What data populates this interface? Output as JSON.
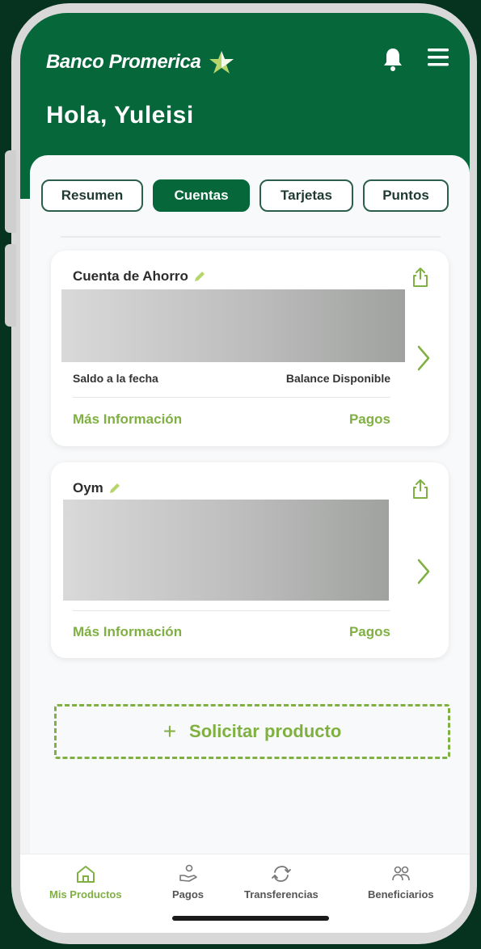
{
  "header": {
    "brand": "Banco Promerica",
    "greeting": "Hola, Yuleisi"
  },
  "tabs": [
    {
      "label": "Resumen",
      "active": false
    },
    {
      "label": "Cuentas",
      "active": true
    },
    {
      "label": "Tarjetas",
      "active": false
    },
    {
      "label": "Puntos",
      "active": false
    }
  ],
  "accounts": [
    {
      "name": "Cuenta de Ahorro",
      "saldo_label": "Saldo a la fecha",
      "balance_label": "Balance Disponible",
      "more_label": "Más Información",
      "pagos_label": "Pagos"
    },
    {
      "name": "Oym",
      "more_label": "Más Información",
      "pagos_label": "Pagos"
    }
  ],
  "solicitar": {
    "label": "Solicitar producto"
  },
  "bottom_nav": [
    {
      "label": "Mis Productos",
      "icon": "home-icon",
      "active": true
    },
    {
      "label": "Pagos",
      "icon": "payment-hand-icon",
      "active": false
    },
    {
      "label": "Transferencias",
      "icon": "transfer-arrows-icon",
      "active": false
    },
    {
      "label": "Beneficiarios",
      "icon": "users-icon",
      "active": false
    }
  ],
  "colors": {
    "brand_green": "#06673a",
    "accent_green": "#7fb041",
    "background_dark": "#05331f"
  }
}
